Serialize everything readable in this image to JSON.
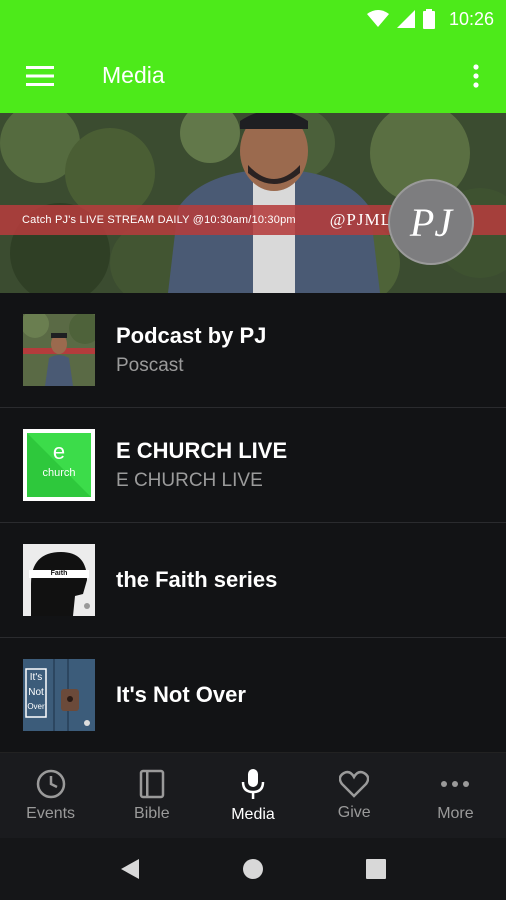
{
  "status_bar": {
    "time": "10:26",
    "icons": [
      "wifi-icon",
      "signal-icon",
      "battery-icon"
    ]
  },
  "toolbar": {
    "title": "Media",
    "menu_icon": "hamburger-menu-icon",
    "more_icon": "more-vertical-icon"
  },
  "banner": {
    "strip_text": "Catch PJ's LIVE STREAM DAILY @10:30am/10:30pm",
    "handle": "@PJMLIVE",
    "logo_text": "PJ"
  },
  "media_list": [
    {
      "title": "Podcast by PJ",
      "subtitle": "Poscast"
    },
    {
      "title": "E CHURCH LIVE",
      "subtitle": "E CHURCH LIVE"
    },
    {
      "title": "the Faith series",
      "subtitle": ""
    },
    {
      "title": "It's Not Over",
      "subtitle": ""
    }
  ],
  "thumbnails": {
    "echurch_letter": "e",
    "echurch_word": "church",
    "faith_word": "Faith",
    "notover_lines": [
      "It's",
      "Not",
      "Over"
    ]
  },
  "bottom_nav": [
    {
      "label": "Events",
      "icon": "clock-icon",
      "active": false
    },
    {
      "label": "Bible",
      "icon": "book-icon",
      "active": false
    },
    {
      "label": "Media",
      "icon": "microphone-icon",
      "active": true
    },
    {
      "label": "Give",
      "icon": "heart-icon",
      "active": false
    },
    {
      "label": "More",
      "icon": "more-horizontal-icon",
      "active": false
    }
  ],
  "colors": {
    "accent": "#4dea1a",
    "background": "#121315",
    "banner_strip": "#b43c3c"
  }
}
